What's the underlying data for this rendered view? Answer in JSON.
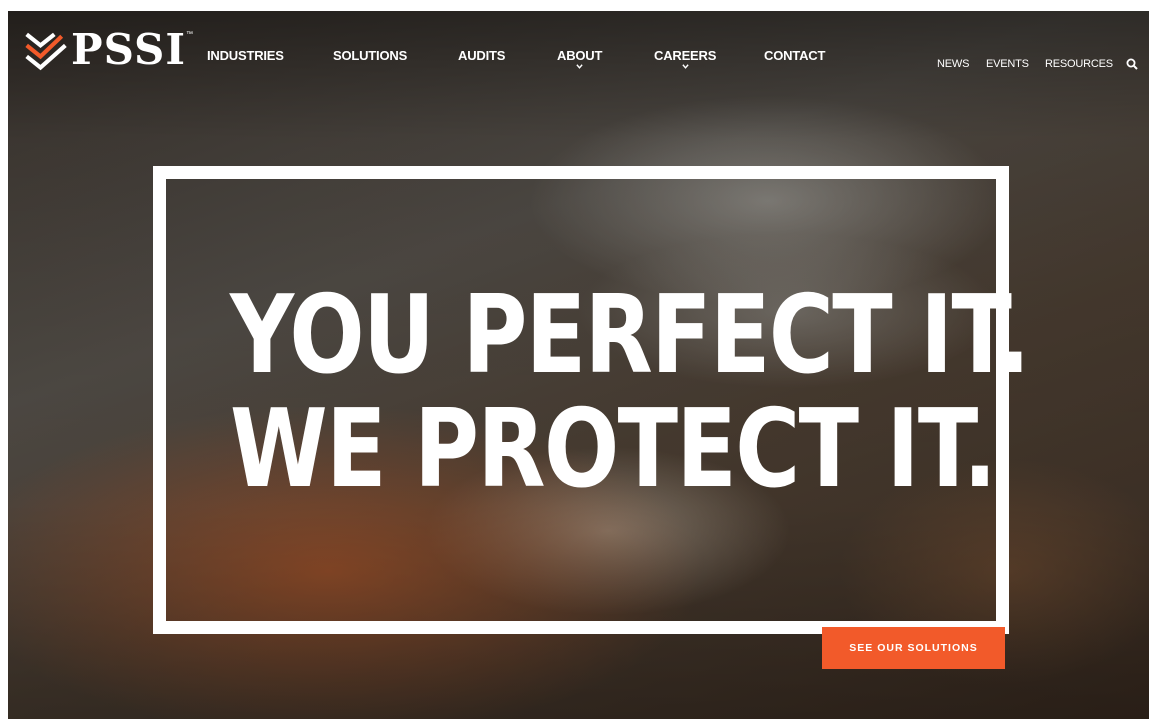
{
  "brand": {
    "name": "PSSI",
    "trademark": "™",
    "accent_color": "#f25a2a",
    "logo_icon": "chevron-stack-icon"
  },
  "nav": {
    "items": [
      {
        "label": "INDUSTRIES",
        "has_dropdown": false
      },
      {
        "label": "SOLUTIONS",
        "has_dropdown": false
      },
      {
        "label": "AUDITS",
        "has_dropdown": false
      },
      {
        "label": "ABOUT",
        "has_dropdown": true
      },
      {
        "label": "CAREERS",
        "has_dropdown": true
      },
      {
        "label": "CONTACT",
        "has_dropdown": false
      }
    ],
    "utility": [
      "NEWS",
      "EVENTS",
      "RESOURCES"
    ],
    "search_icon": "search-icon"
  },
  "hero": {
    "headline_line1": "YOU PERFECT IT.",
    "headline_line2": "WE PROTECT IT.",
    "cta_label": "SEE OUR SOLUTIONS"
  }
}
